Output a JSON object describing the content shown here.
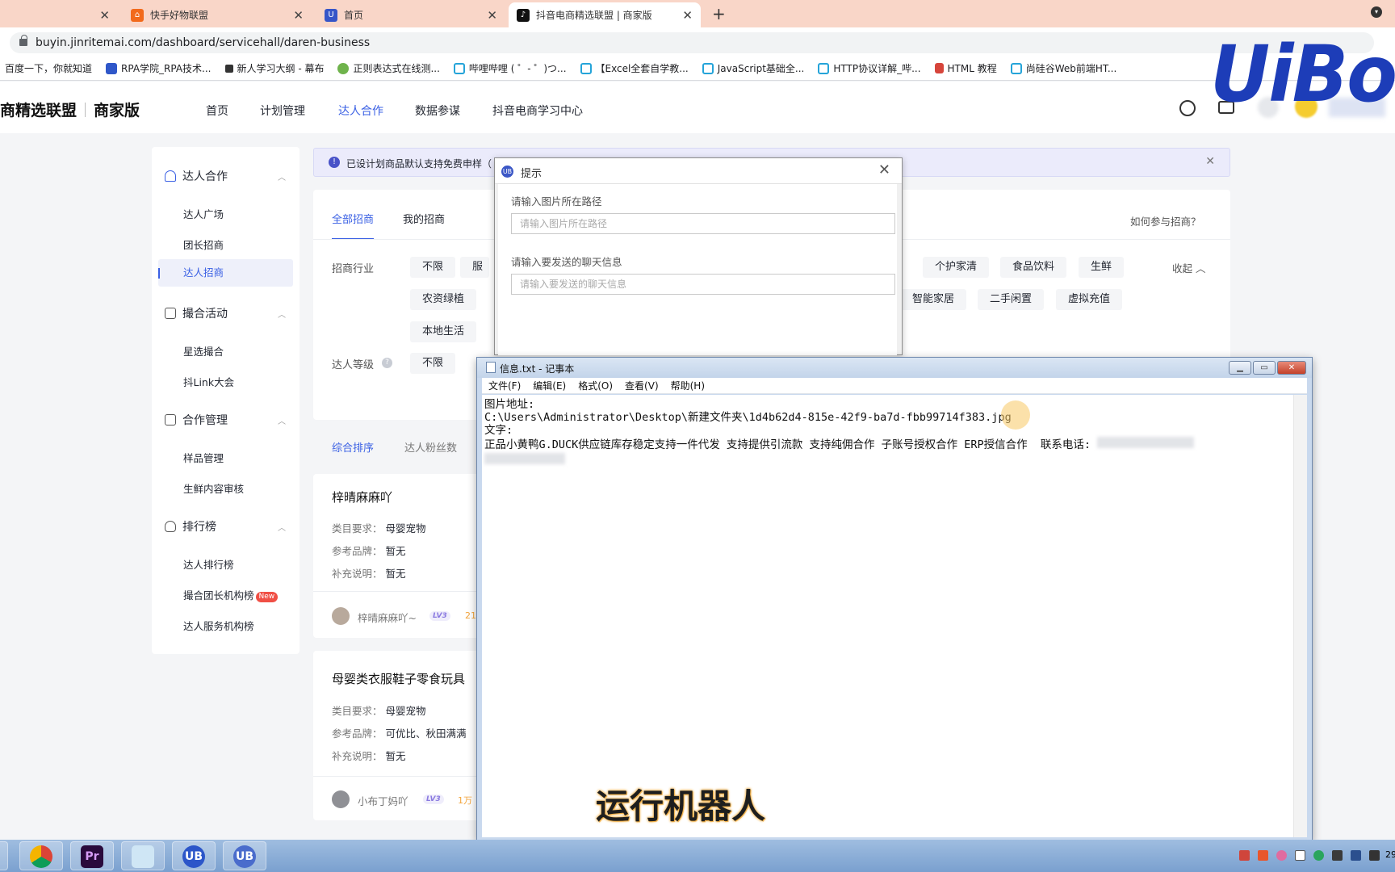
{
  "browser": {
    "tabs": [
      {
        "label": "",
        "active": false
      },
      {
        "label": "快手好物联盟",
        "active": false
      },
      {
        "label": "首页",
        "active": false
      },
      {
        "label": "抖音电商精选联盟 | 商家版",
        "active": true
      }
    ],
    "new_tab": "+",
    "url": "buyin.jinritemai.com/dashboard/servicehall/daren-business",
    "bookmarks": [
      "百度一下，你就知道",
      "RPA学院_RPA技术...",
      "新人学习大纲 - 幕布",
      "正则表达式在线测...",
      "哔哩哔哩 ( ゜- ゜)つ...",
      "【Excel全套自学教...",
      "JavaScript基础全...",
      "HTTP协议详解_哔...",
      "HTML 教程",
      "尚硅谷Web前端HT..."
    ]
  },
  "header": {
    "logo_left": "商精选联盟",
    "logo_right": "商家版",
    "nav": [
      "首页",
      "计划管理",
      "达人合作",
      "数据参谋",
      "抖音电商学习中心"
    ],
    "active_nav": "达人合作"
  },
  "sidebar": {
    "groups": [
      {
        "label": "达人合作",
        "items": [
          "达人广场",
          "团长招商",
          "达人招商"
        ]
      },
      {
        "label": "撮合活动",
        "items": [
          "星选撮合",
          "抖Link大会"
        ]
      },
      {
        "label": "合作管理",
        "items": [
          "样品管理",
          "生鲜内容审核"
        ]
      },
      {
        "label": "排行榜",
        "items": [
          "达人排行榜",
          "撮合团长机构榜",
          "达人服务机构榜"
        ]
      }
    ],
    "active_item": "达人招商",
    "new_badge": "New"
  },
  "notice": {
    "text": "已设计划商品默认支持免费申样（",
    "icon": "!"
  },
  "recruit": {
    "tabs": [
      "全部招商",
      "我的招商"
    ],
    "help_link": "如何参与招商？",
    "industry_label": "招商行业",
    "industry_chips_row1": [
      "不限",
      "服",
      "个护家清",
      "食品饮料",
      "生鲜"
    ],
    "industry_chips_row2": [
      "农资绿植",
      "智能家居",
      "二手闲置",
      "虚拟充值"
    ],
    "industry_chips_row3": [
      "本地生活"
    ],
    "collapse": "收起",
    "level_label": "达人等级",
    "level_chips": [
      "不限"
    ]
  },
  "sort": {
    "items": [
      "综合排序",
      "达人粉丝数"
    ]
  },
  "list": [
    {
      "title": "梓晴麻麻吖",
      "category_label": "类目要求：",
      "category": "母婴宠物",
      "brand_label": "参考品牌：",
      "brand": "暂无",
      "note_label": "补充说明：",
      "note": "暂无",
      "author": "梓晴麻麻吖~",
      "level": "LV3",
      "extra": "21"
    },
    {
      "title": "母婴类衣服鞋子零食玩具",
      "category_label": "类目要求：",
      "category": "母婴宠物",
      "brand_label": "参考品牌：",
      "brand": "可优比、秋田满满",
      "note_label": "补充说明：",
      "note": "暂无",
      "author": "小布丁妈吖",
      "level": "LV3",
      "extra": "1万"
    }
  ],
  "dialog": {
    "title": "提示",
    "label1": "请输入图片所在路径",
    "placeholder1": "请输入图片所在路径",
    "label2": "请输入要发送的聊天信息",
    "placeholder2": "请输入要发送的聊天信息"
  },
  "notepad": {
    "title": "信息.txt - 记事本",
    "menu": [
      "文件(F)",
      "编辑(E)",
      "格式(O)",
      "查看(V)",
      "帮助(H)"
    ],
    "lines": [
      "图片地址:",
      "C:\\Users\\Administrator\\Desktop\\新建文件夹\\1d4b62d4-815e-42f9-ba7d-fbb99714f383.jpg",
      "",
      "文字:",
      "正品小黄鸭G.DUCK供应链库存稳定支持一件代发 支持提供引流款 支持纯佣合作 子账号授权合作 ERP授信合作  联系电话:"
    ]
  },
  "overlay": {
    "brand": "UiBot",
    "caption": "运行机器人"
  },
  "taskbar": {
    "clock": "29"
  },
  "colors": {
    "accent": "#3a60e4",
    "tab_bar": "#f9d6c8",
    "uibot_blue": "#1d3db8"
  }
}
